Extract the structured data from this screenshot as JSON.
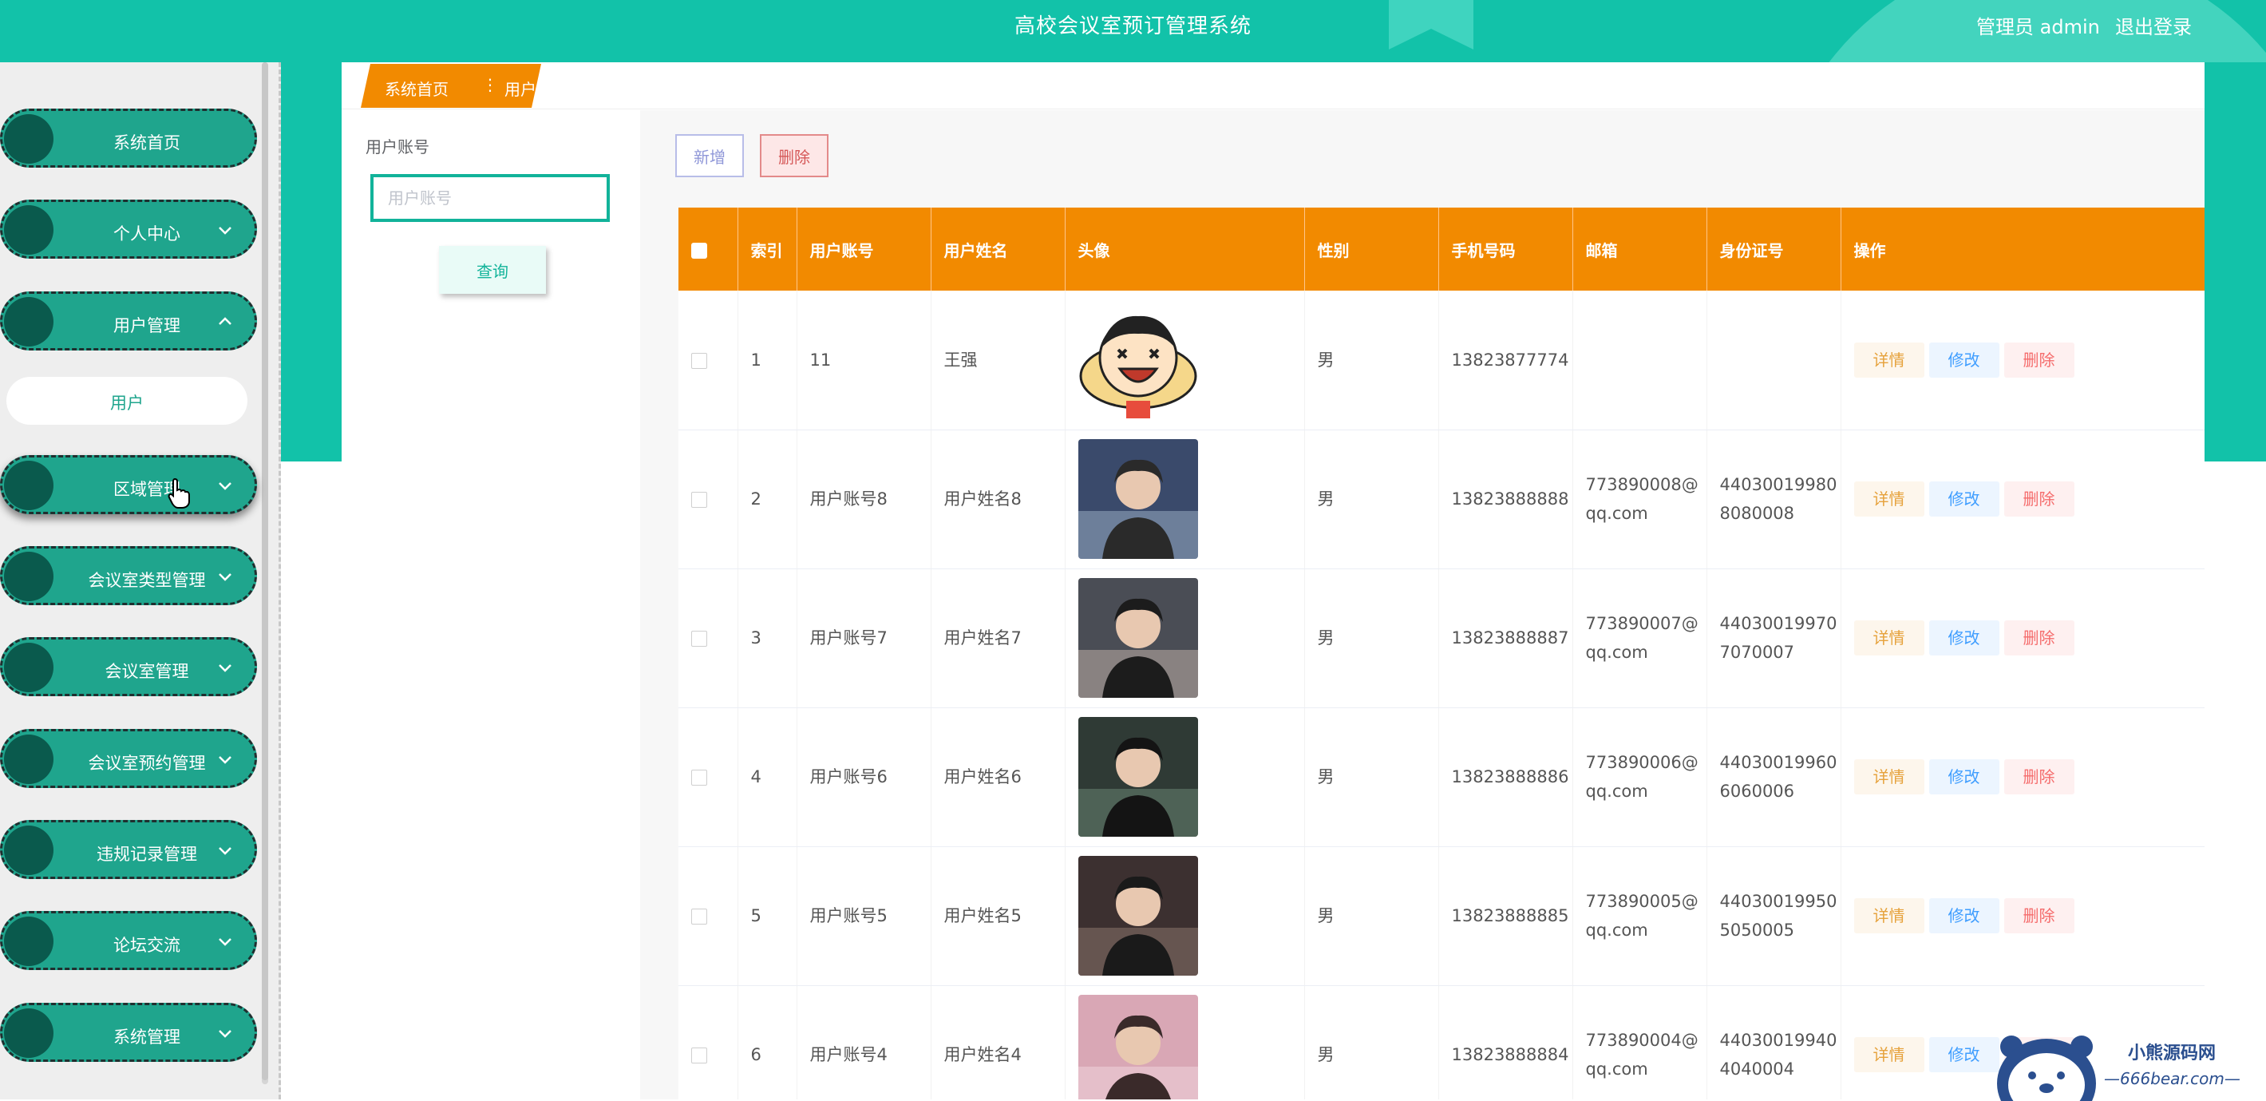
{
  "header": {
    "app_title": "高校会议室预订管理系统",
    "admin_label": "管理员 admin",
    "logout_label": "退出登录"
  },
  "sidebar": {
    "items": [
      {
        "label": "系统首页"
      },
      {
        "label": "个人中心"
      },
      {
        "label": "用户管理",
        "expanded": true
      },
      {
        "label": "区域管理"
      },
      {
        "label": "会议室类型管理"
      },
      {
        "label": "会议室管理"
      },
      {
        "label": "会议室预约管理"
      },
      {
        "label": "违规记录管理"
      },
      {
        "label": "论坛交流"
      },
      {
        "label": "系统管理"
      }
    ],
    "submenu": {
      "label": "用户"
    }
  },
  "breadcrumb": {
    "home": "系统首页",
    "current": "用户"
  },
  "search": {
    "label": "用户账号",
    "placeholder": "用户账号",
    "button": "查询"
  },
  "toolbar": {
    "add_label": "新增",
    "delete_label": "删除"
  },
  "table": {
    "columns": [
      "索引",
      "用户账号",
      "用户姓名",
      "头像",
      "性别",
      "手机号码",
      "邮箱",
      "身份证号",
      "操作"
    ],
    "rows": [
      {
        "index": "1",
        "account": "11",
        "name": "王强",
        "avatar": "cartoon-avatar",
        "gender": "男",
        "phone": "13823877774",
        "email_1": "",
        "email_2": "",
        "id_1": "",
        "id_2": ""
      },
      {
        "index": "2",
        "account": "用户账号8",
        "name": "用户姓名8",
        "avatar": "photo-avatar",
        "gender": "男",
        "phone": "13823888888",
        "email_1": "773890008@",
        "email_2": "qq.com",
        "id_1": "44030019980",
        "id_2": "8080008"
      },
      {
        "index": "3",
        "account": "用户账号7",
        "name": "用户姓名7",
        "avatar": "photo-avatar",
        "gender": "男",
        "phone": "13823888887",
        "email_1": "773890007@",
        "email_2": "qq.com",
        "id_1": "44030019970",
        "id_2": "7070007"
      },
      {
        "index": "4",
        "account": "用户账号6",
        "name": "用户姓名6",
        "avatar": "photo-avatar",
        "gender": "男",
        "phone": "13823888886",
        "email_1": "773890006@",
        "email_2": "qq.com",
        "id_1": "44030019960",
        "id_2": "6060006"
      },
      {
        "index": "5",
        "account": "用户账号5",
        "name": "用户姓名5",
        "avatar": "photo-avatar",
        "gender": "男",
        "phone": "13823888885",
        "email_1": "773890005@",
        "email_2": "qq.com",
        "id_1": "44030019950",
        "id_2": "5050005"
      },
      {
        "index": "6",
        "account": "用户账号4",
        "name": "用户姓名4",
        "avatar": "photo-avatar",
        "gender": "男",
        "phone": "13823888884",
        "email_1": "773890004@",
        "email_2": "qq.com",
        "id_1": "44030019940",
        "id_2": "4040004"
      }
    ],
    "actions": {
      "detail": "详情",
      "edit": "修改",
      "delete": "删除"
    }
  },
  "watermark": {
    "line1": "小熊源码网",
    "line2": "—666bear.com—"
  },
  "colors": {
    "primary_teal": "#12c2a9",
    "menu_teal": "#1fa58d",
    "header_orange": "#f28a00"
  }
}
